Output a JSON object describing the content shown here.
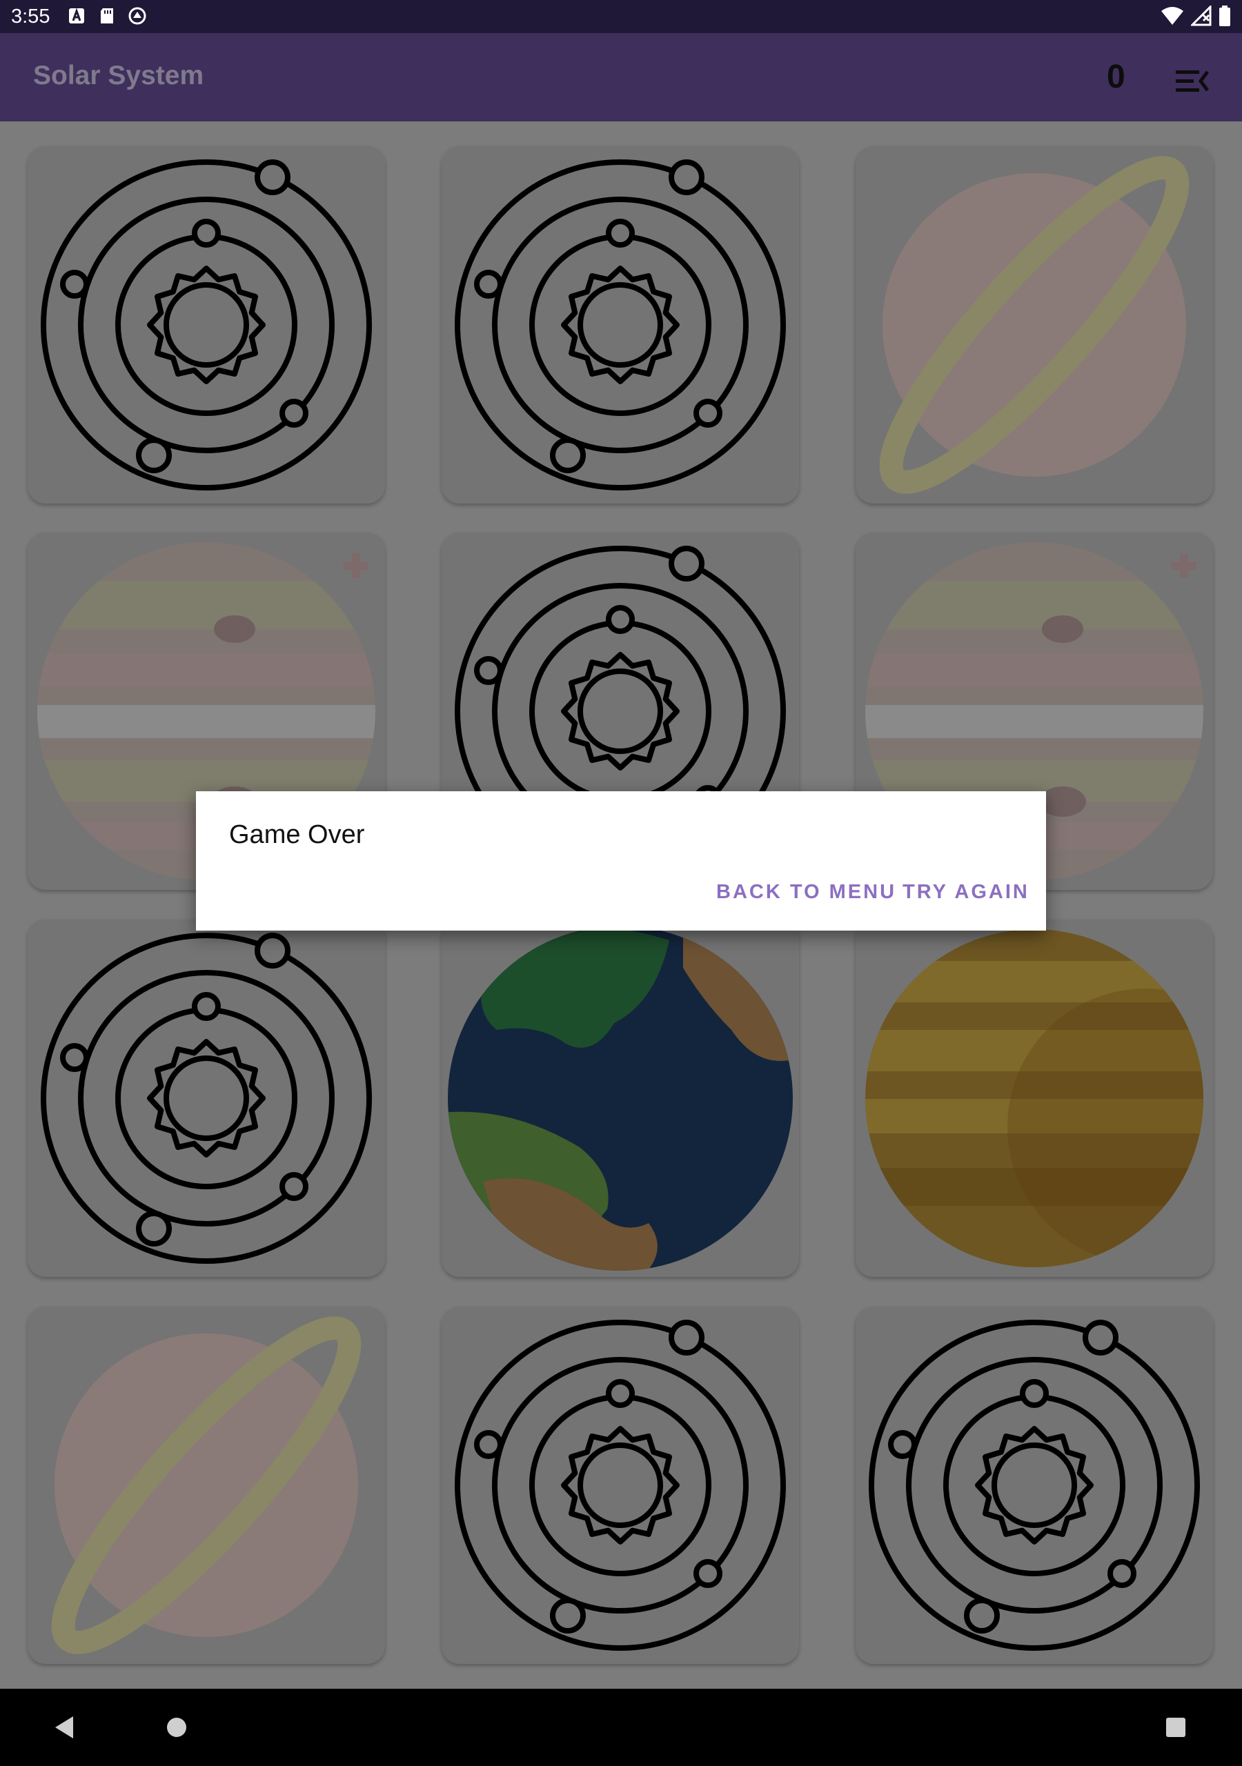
{
  "status_bar": {
    "time": "3:55",
    "left_icons": [
      "a-icon",
      "sd-card-icon",
      "sync-icon"
    ],
    "right_icons": [
      "wifi-icon",
      "signal-icon",
      "battery-icon"
    ]
  },
  "app_bar": {
    "title": "Solar System",
    "score": "0",
    "menu_icon": "menu-open-icon",
    "background": "#3f2f5c"
  },
  "cards": [
    {
      "face": "solar-system-icon"
    },
    {
      "face": "solar-system-icon"
    },
    {
      "face": "saturn-icon"
    },
    {
      "face": "jupiter-icon"
    },
    {
      "face": "solar-system-icon"
    },
    {
      "face": "jupiter-icon"
    },
    {
      "face": "solar-system-icon"
    },
    {
      "face": "earth-icon"
    },
    {
      "face": "venus-icon"
    },
    {
      "face": "saturn-icon"
    },
    {
      "face": "solar-system-icon"
    },
    {
      "face": "solar-system-icon"
    }
  ],
  "dialog": {
    "title": "Game Over",
    "back_to_menu": "BACK TO MENU",
    "try_again": "TRY AGAIN",
    "button_color": "#8c6fc0"
  },
  "nav_bar": {
    "icons": [
      "back-icon",
      "home-icon",
      "recents-icon"
    ]
  }
}
